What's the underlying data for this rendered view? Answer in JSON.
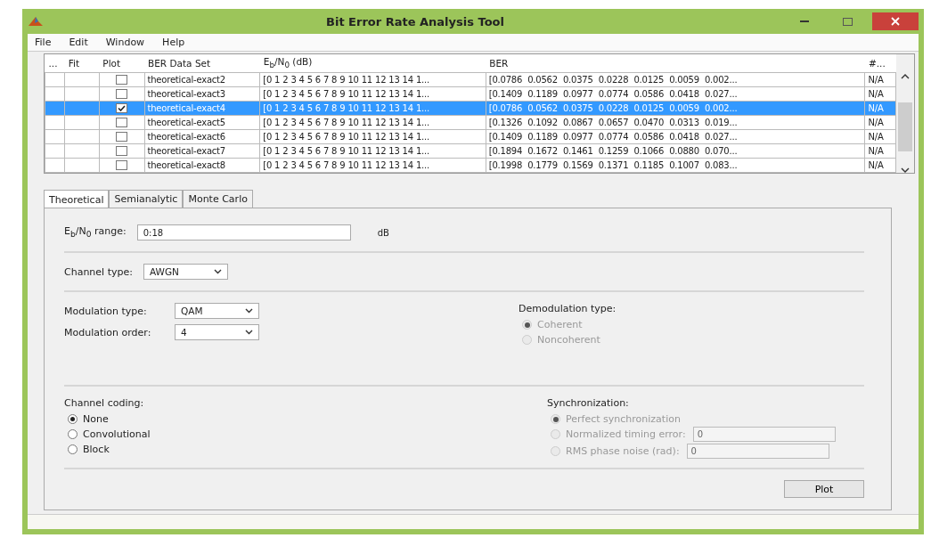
{
  "window": {
    "title": "Bit Error Rate Analysis Tool"
  },
  "menu": [
    "File",
    "Edit",
    "Window",
    "Help"
  ],
  "table": {
    "columns": [
      "...",
      "Fit",
      "Plot",
      "BER Data Set",
      "E$_{b}$/N$_{0}$ (dB)",
      "BER",
      "#..."
    ],
    "rows": [
      {
        "plot": false,
        "selected": false,
        "name": "theoretical-exact2",
        "ebno": "[0 1 2 3 4 5 6 7 8 9 10 11 12 13 14 1...",
        "ber": "[0.0786  0.0562  0.0375  0.0228  0.0125  0.0059  0.002...",
        "count": "N/A"
      },
      {
        "plot": false,
        "selected": false,
        "name": "theoretical-exact3",
        "ebno": "[0 1 2 3 4 5 6 7 8 9 10 11 12 13 14 1...",
        "ber": "[0.1409  0.1189  0.0977  0.0774  0.0586  0.0418  0.027...",
        "count": "N/A"
      },
      {
        "plot": true,
        "selected": true,
        "name": "theoretical-exact4",
        "ebno": "[0 1 2 3 4 5 6 7 8 9 10 11 12 13 14 1...",
        "ber": "[0.0786  0.0562  0.0375  0.0228  0.0125  0.0059  0.002...",
        "count": "N/A"
      },
      {
        "plot": false,
        "selected": false,
        "name": "theoretical-exact5",
        "ebno": "[0 1 2 3 4 5 6 7 8 9 10 11 12 13 14 1...",
        "ber": "[0.1326  0.1092  0.0867  0.0657  0.0470  0.0313  0.019...",
        "count": "N/A"
      },
      {
        "plot": false,
        "selected": false,
        "name": "theoretical-exact6",
        "ebno": "[0 1 2 3 4 5 6 7 8 9 10 11 12 13 14 1...",
        "ber": "[0.1409  0.1189  0.0977  0.0774  0.0586  0.0418  0.027...",
        "count": "N/A"
      },
      {
        "plot": false,
        "selected": false,
        "name": "theoretical-exact7",
        "ebno": "[0 1 2 3 4 5 6 7 8 9 10 11 12 13 14 1...",
        "ber": "[0.1894  0.1672  0.1461  0.1259  0.1066  0.0880  0.070...",
        "count": "N/A"
      },
      {
        "plot": false,
        "selected": false,
        "name": "theoretical-exact8",
        "ebno": "[0 1 2 3 4 5 6 7 8 9 10 11 12 13 14 1...",
        "ber": "[0.1998  0.1779  0.1569  0.1371  0.1185  0.1007  0.083...",
        "count": "N/A"
      }
    ]
  },
  "tabs": [
    {
      "label": "Theoretical",
      "selected": true
    },
    {
      "label": "Semianalytic",
      "selected": false
    },
    {
      "label": "Monte Carlo",
      "selected": false
    }
  ],
  "ebno_range": {
    "label": "E$_{b}$/N$_{0}$ range:",
    "value": "0:18",
    "unit": "dB"
  },
  "channel_type": {
    "label": "Channel type:",
    "value": "AWGN"
  },
  "modulation_type": {
    "label": "Modulation type:",
    "value": "QAM"
  },
  "modulation_order": {
    "label": "Modulation order:",
    "value": "4"
  },
  "demodulation": {
    "title": "Demodulation type:",
    "options": [
      {
        "label": "Coherent",
        "selected": true,
        "disabled": true
      },
      {
        "label": "Noncoherent",
        "selected": false,
        "disabled": true
      }
    ]
  },
  "channel_coding": {
    "title": "Channel coding:",
    "options": [
      {
        "label": "None",
        "selected": true,
        "disabled": false
      },
      {
        "label": "Convolutional",
        "selected": false,
        "disabled": false
      },
      {
        "label": "Block",
        "selected": false,
        "disabled": false
      }
    ]
  },
  "synchronization": {
    "title": "Synchronization:",
    "options": [
      {
        "label": "Perfect synchronization",
        "selected": true,
        "disabled": true
      },
      {
        "label": "Normalized timing error:",
        "selected": false,
        "disabled": true,
        "value": "0"
      },
      {
        "label": "RMS phase noise (rad):",
        "selected": false,
        "disabled": true,
        "value": "0"
      }
    ]
  },
  "plot_button": "Plot"
}
